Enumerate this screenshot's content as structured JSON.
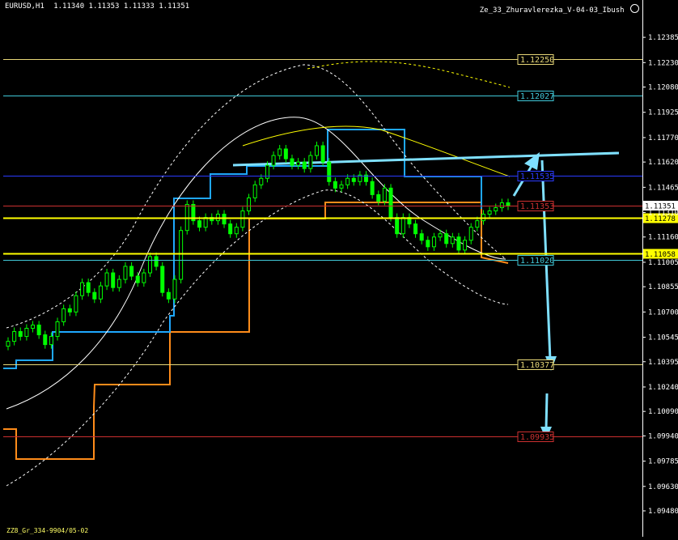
{
  "header": {
    "symbol": "EURUSD,H1",
    "ohlc": "1.11340 1.11353 1.11333 1.11351",
    "indicator": "Ze_33_Zhuravlerezka_V-04-03_Ibush"
  },
  "footer": {
    "text": "ZZ8_Gr_334-9904/05-02"
  },
  "colors": {
    "background": "#000000",
    "candle": "#00ff00",
    "axis": "#ffffff",
    "orange": "#ff8c1a",
    "cyan_step": "#1fa8ff",
    "arrow": "#7fe0ff",
    "yellow": "#ffff00",
    "red": "#ff3030",
    "blue": "#2b3bff",
    "teal": "#30b8c8"
  },
  "chart_data": {
    "type": "candlestick",
    "ylim": [
      1.0948,
      1.1246
    ],
    "y_ticks": [
      "1.12385",
      "1.12230",
      "1.12080",
      "1.11925",
      "1.11770",
      "1.11620",
      "1.11465",
      "1.11310",
      "1.11160",
      "1.11005",
      "1.10855",
      "1.10700",
      "1.10545",
      "1.10395",
      "1.10240",
      "1.10090",
      "1.09940",
      "1.09785",
      "1.09630",
      "1.09480"
    ],
    "current_price": "1.11351",
    "price_labels": [
      {
        "text": "1.11278",
        "value": 1.11278,
        "style": "yellow-box"
      },
      {
        "text": "1.11058",
        "value": 1.11058,
        "style": "yellow-box"
      }
    ],
    "levels": [
      {
        "label": "1.12250",
        "value": 1.1225,
        "color": "#e8d878"
      },
      {
        "label": "1.12027",
        "value": 1.12027,
        "color": "#40c8d8"
      },
      {
        "label": "1.11535",
        "value": 1.11535,
        "color": "#2b3bff"
      },
      {
        "label": "1.11353",
        "value": 1.11353,
        "color": "#cc3030"
      },
      {
        "label": "1.11020",
        "value": 1.1102,
        "color": "#40c8d8"
      },
      {
        "label": "1.10377",
        "value": 1.10377,
        "color": "#e8d878"
      },
      {
        "label": "1.09935",
        "value": 1.09935,
        "color": "#cc3030"
      }
    ],
    "candles_close": [
      1.1052,
      1.1058,
      1.1055,
      1.106,
      1.1062,
      1.1056,
      1.105,
      1.1055,
      1.1064,
      1.1072,
      1.107,
      1.108,
      1.1088,
      1.1082,
      1.1078,
      1.1086,
      1.1094,
      1.1085,
      1.109,
      1.1098,
      1.1092,
      1.1088,
      1.1094,
      1.1104,
      1.1098,
      1.1082,
      1.1078,
      1.109,
      1.112,
      1.1136,
      1.1126,
      1.1122,
      1.1128,
      1.1126,
      1.113,
      1.1124,
      1.1118,
      1.1122,
      1.1132,
      1.114,
      1.1148,
      1.1152,
      1.116,
      1.1166,
      1.117,
      1.1164,
      1.116,
      1.1162,
      1.1158,
      1.1166,
      1.1172,
      1.1162,
      1.115,
      1.1146,
      1.1148,
      1.1152,
      1.115,
      1.1154,
      1.115,
      1.1142,
      1.1138,
      1.1146,
      1.1128,
      1.1118,
      1.1128,
      1.1124,
      1.1118,
      1.1114,
      1.111,
      1.1116,
      1.1118,
      1.1112,
      1.1116,
      1.1108,
      1.1114,
      1.1122,
      1.1126,
      1.113,
      1.1132,
      1.1134,
      1.1137,
      1.1135
    ]
  }
}
